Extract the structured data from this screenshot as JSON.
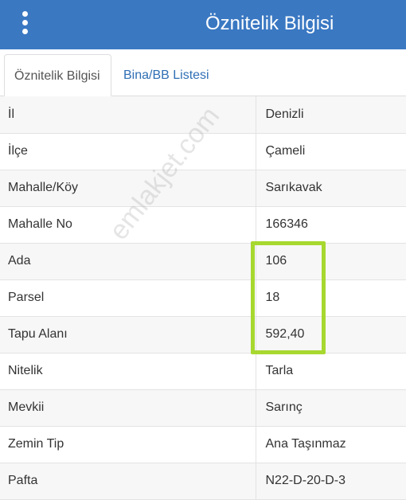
{
  "header": {
    "menu_icon": "more-vertical-icon",
    "title": "Öznitelik Bilgisi",
    "background_color": "#3a78c2"
  },
  "tabs": [
    {
      "label": "Öznitelik Bilgisi",
      "active": true
    },
    {
      "label": "Bina/BB Listesi",
      "active": false
    }
  ],
  "attributes": [
    {
      "label": "İl",
      "value": "Denizli"
    },
    {
      "label": "İlçe",
      "value": "Çameli"
    },
    {
      "label": "Mahalle/Köy",
      "value": "Sarıkavak"
    },
    {
      "label": "Mahalle No",
      "value": "166346"
    },
    {
      "label": "Ada",
      "value": "106"
    },
    {
      "label": "Parsel",
      "value": "18"
    },
    {
      "label": "Tapu Alanı",
      "value": "592,40"
    },
    {
      "label": "Nitelik",
      "value": "Tarla"
    },
    {
      "label": "Mevkii",
      "value": "Sarınç"
    },
    {
      "label": "Zemin Tip",
      "value": "Ana Taşınmaz"
    },
    {
      "label": "Pafta",
      "value": "N22-D-20-D-3"
    }
  ],
  "watermark": "emlakjet.com",
  "highlight_color": "#a7d82f"
}
